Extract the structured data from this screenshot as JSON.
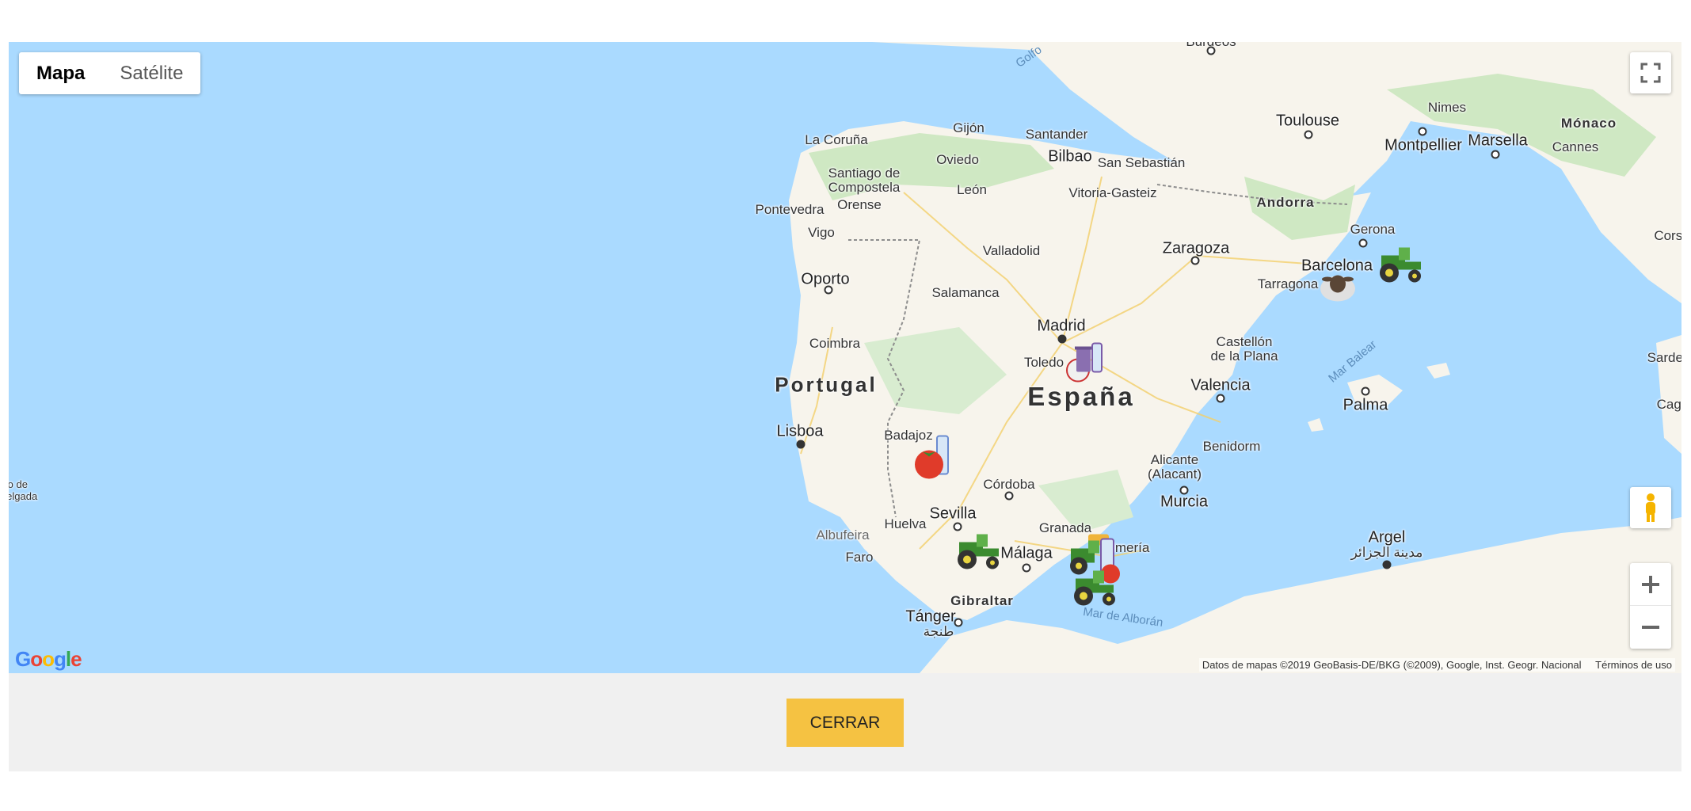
{
  "map_type": {
    "map_label": "Mapa",
    "satellite_label": "Satélite",
    "active": "Mapa"
  },
  "attribution": {
    "data_text": "Datos de mapas ©2019 GeoBasis-DE/BKG (©2009), Google, Inst. Geogr. Nacional",
    "terms_text": "Términos de uso"
  },
  "google_logo": "Google",
  "close_button": {
    "label": "CERRAR"
  },
  "icons": {
    "fullscreen": "fullscreen-icon",
    "pegman": "pegman-icon",
    "zoom_in": "plus-icon",
    "zoom_out": "minus-icon"
  },
  "colors": {
    "water": "#aadaff",
    "land": "#f7f4ec",
    "green": "#cce8c0",
    "button": "#f5c242",
    "footer": "#f0f0f0"
  },
  "labels": {
    "golfo": "Golfo",
    "burdeos": "Burdeos",
    "toulouse": "Toulouse",
    "nimes": "Nimes",
    "montpellier": "Montpellier",
    "marsella": "Marsella",
    "monaco": "Mónaco",
    "cannes": "Cannes",
    "andorra": "Andorra",
    "gerona": "Gerona",
    "barcelona": "Barcelona",
    "tarragona": "Tarragona",
    "corse": "Corse",
    "sardeg": "Sardeg",
    "cagli": "Cagli",
    "la_coruna": "La Coruña",
    "gijon": "Gijón",
    "santander": "Santander",
    "oviedo": "Oviedo",
    "bilbao": "Bilbao",
    "san_sebastian": "San Sebastián",
    "santiago": "Santiago de\nCompostela",
    "leon": "León",
    "vitoria": "Vitoria-Gasteiz",
    "pontevedra": "Pontevedra",
    "orense": "Orense",
    "vigo": "Vigo",
    "zaragoza": "Zaragoza",
    "valladolid": "Valladolid",
    "oporto": "Oporto",
    "salamanca": "Salamanca",
    "madrid": "Madrid",
    "coimbra": "Coimbra",
    "toledo": "Toledo",
    "castellon": "Castellón\nde la Plana",
    "mar_balear": "Mar Balear",
    "portugal": "Portugal",
    "espana": "España",
    "valencia": "Valencia",
    "palma": "Palma",
    "lisboa": "Lisboa",
    "badajoz": "Badajoz",
    "benidorm": "Benidorm",
    "alicante": "Alicante\n(Alacant)",
    "ponta": "nto de\nDelgada",
    "cordoba": "Córdoba",
    "murcia": "Murcia",
    "sevilla": "Sevilla",
    "huelva": "Huelva",
    "granada": "Granada",
    "albufeira": "Albufeira",
    "faro": "Faro",
    "malaga": "Málaga",
    "almeria": "Almería",
    "argel": "Argel",
    "argel_ar": "مدينة الجزائر",
    "gibraltar": "Gibraltar",
    "mar_alboran": "Mar de Alborán",
    "tanger": "Tánger",
    "tanger_ar": "طنجة"
  },
  "markers": [
    {
      "name": "tractor-marker-barcelona",
      "icon": "tractor-icon"
    },
    {
      "name": "sheep-marker-tarragona",
      "icon": "sheep-icon"
    },
    {
      "name": "trash-marker-toledo",
      "icon": "trash-bin-icon"
    },
    {
      "name": "tomato-marker-badajoz",
      "icon": "tomato-icon"
    },
    {
      "name": "tractor-marker-sevilla",
      "icon": "tractor-icon"
    },
    {
      "name": "tractor-cluster-granada",
      "icon": "tractor-icon"
    }
  ]
}
